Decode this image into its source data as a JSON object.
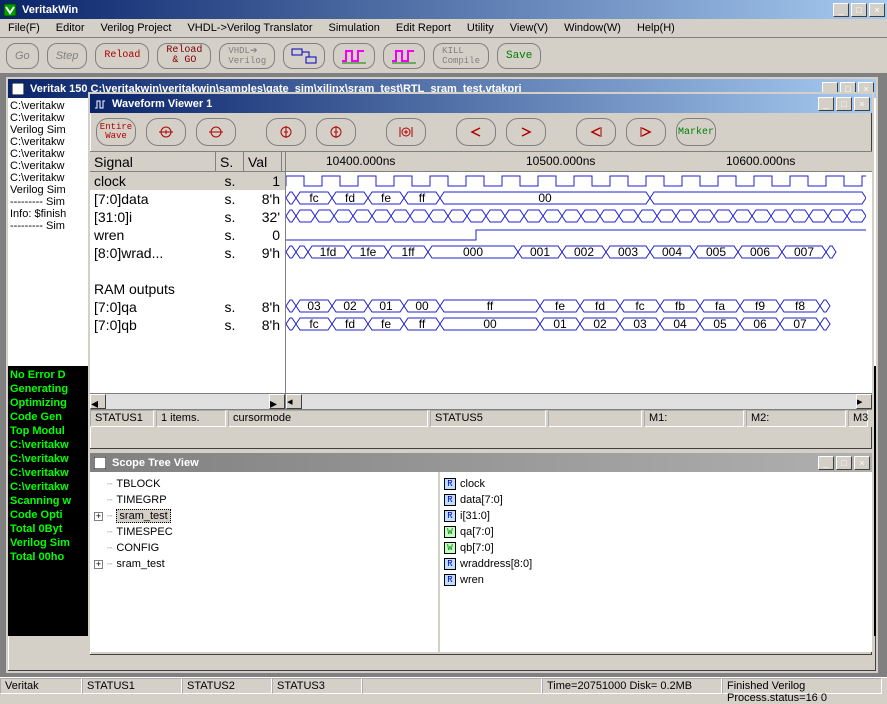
{
  "title": "VeritakWin",
  "menu": [
    "File(F)",
    "Editor",
    "Verilog Project",
    "VHDL->Verilog Translator",
    "Simulation",
    "Edit Report",
    "Utility",
    "View(V)",
    "Window(W)",
    "Help(H)"
  ],
  "toolbar": {
    "go": "Go",
    "step": "Step",
    "reload": "Reload",
    "reloadgo": "Reload\n& GO",
    "vhdl": "VHDL➔\nVerilog",
    "kill": "KILL\nCompile",
    "save": "Save"
  },
  "logwin": {
    "title": "Veritak 150 C:\\veritakwin\\veritakwin\\samples\\gate_sim\\xilinx\\sram_test\\RTL_sram_test.vtakprj",
    "white": [
      "C:\\veritakw",
      "C:\\veritakw",
      "Verilog Sim",
      "",
      "C:\\veritakw",
      "C:\\veritakw",
      "C:\\veritakw",
      "C:\\veritakw",
      "Verilog Sim",
      "--------- Sim",
      "",
      "Info: $finish",
      "",
      "--------- Sim"
    ],
    "black": [
      "No Error D",
      "Generating",
      "Optimizing",
      "Code Gen",
      "Top Modul",
      "C:\\veritakw",
      "C:\\veritakw",
      "C:\\veritakw",
      "C:\\veritakw",
      "Scanning w",
      "Code Opti",
      "Total 0Byt",
      "Verilog Sim",
      "Total 00ho"
    ]
  },
  "wave": {
    "title": "Waveform Viewer 1",
    "entire": "Entire\nWave",
    "marker": "Marker",
    "hdr": {
      "sig": "Signal",
      "s": "S.",
      "val": "Val"
    },
    "times": [
      "10400.000ns",
      "10500.000ns",
      "10600.000ns"
    ],
    "signals": [
      {
        "name": "clock",
        "s": "s.",
        "val": "1",
        "sel": true
      },
      {
        "name": "[7:0]data",
        "s": "s.",
        "val": "8'h"
      },
      {
        "name": "[31:0]i",
        "s": "s.",
        "val": "32'"
      },
      {
        "name": "wren",
        "s": "s.",
        "val": "0"
      },
      {
        "name": "[8:0]wrad...",
        "s": "s.",
        "val": "9'h"
      },
      {
        "name": "",
        "blank": true
      },
      {
        "name": "RAM outputs",
        "heading": true
      },
      {
        "name": "[7:0]qa",
        "s": "s.",
        "val": "8'h"
      },
      {
        "name": "[7:0]qb",
        "s": "s.",
        "val": "8'h"
      }
    ],
    "status": {
      "s1": "STATUS1",
      "s2": "1 items.",
      "s3": "cursormode",
      "s4": "STATUS5",
      "s5": "",
      "m1": "M1:",
      "m2": "M2:",
      "m3": "M3"
    }
  },
  "bus_data": {
    "data": [
      "fc",
      "fd",
      "fe",
      "ff",
      "00"
    ],
    "wraddr": [
      "1fd",
      "1fe",
      "1ff",
      "000",
      "001",
      "002",
      "003",
      "004",
      "005",
      "006",
      "007"
    ],
    "qa": [
      "03",
      "02",
      "01",
      "00",
      "ff",
      "fe",
      "fd",
      "fc",
      "fb",
      "fa",
      "f9",
      "f8"
    ],
    "qb": [
      "fc",
      "fd",
      "fe",
      "ff",
      "00",
      "01",
      "02",
      "03",
      "04",
      "05",
      "06",
      "07"
    ]
  },
  "scope": {
    "title": "Scope Tree View",
    "left": [
      {
        "label": "TBLOCK"
      },
      {
        "label": "TIMEGRP"
      },
      {
        "label": "sram_test",
        "exp": "+",
        "sel": true
      },
      {
        "label": "TIMESPEC"
      },
      {
        "label": "CONFIG"
      },
      {
        "label": "sram_test",
        "exp": "+"
      }
    ],
    "right": [
      {
        "t": "R",
        "label": "clock"
      },
      {
        "t": "R",
        "label": "data[7:0]"
      },
      {
        "t": "R",
        "label": "i[31:0]"
      },
      {
        "t": "W",
        "label": "qa[7:0]"
      },
      {
        "t": "W",
        "label": "qb[7:0]"
      },
      {
        "t": "R",
        "label": "wraddress[8:0]"
      },
      {
        "t": "R",
        "label": "wren"
      }
    ]
  },
  "mainstatus": [
    "Veritak",
    "STATUS1",
    "STATUS2",
    "STATUS3",
    "",
    "Time=20751000 Disk=  0.2MB",
    "Finished Verilog Process.status=16 0"
  ]
}
